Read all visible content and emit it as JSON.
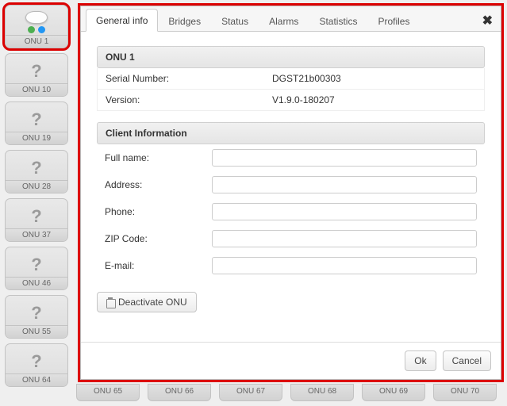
{
  "sidebar": {
    "items": [
      {
        "label": "ONU 1"
      },
      {
        "label": "ONU 10"
      },
      {
        "label": "ONU 19"
      },
      {
        "label": "ONU 28"
      },
      {
        "label": "ONU 37"
      },
      {
        "label": "ONU 46"
      },
      {
        "label": "ONU 55"
      },
      {
        "label": "ONU 64"
      }
    ]
  },
  "bottom": {
    "items": [
      {
        "label": "ONU 65"
      },
      {
        "label": "ONU 66"
      },
      {
        "label": "ONU 67"
      },
      {
        "label": "ONU 68"
      },
      {
        "label": "ONU 69"
      },
      {
        "label": "ONU 70"
      }
    ]
  },
  "dialog": {
    "tabs": {
      "general": "General info",
      "bridges": "Bridges",
      "status": "Status",
      "alarms": "Alarms",
      "statistics": "Statistics",
      "profiles": "Profiles"
    },
    "title": "ONU 1",
    "serial_label": "Serial Number:",
    "serial_value": "DGST21b00303",
    "version_label": "Version:",
    "version_value": "V1.9.0-180207",
    "client_header": "Client Information",
    "fields": {
      "fullname": {
        "label": "Full name:",
        "value": ""
      },
      "address": {
        "label": "Address:",
        "value": ""
      },
      "phone": {
        "label": "Phone:",
        "value": ""
      },
      "zip": {
        "label": "ZIP Code:",
        "value": ""
      },
      "email": {
        "label": "E-mail:",
        "value": ""
      }
    },
    "deactivate": "Deactivate ONU",
    "ok": "Ok",
    "cancel": "Cancel"
  }
}
